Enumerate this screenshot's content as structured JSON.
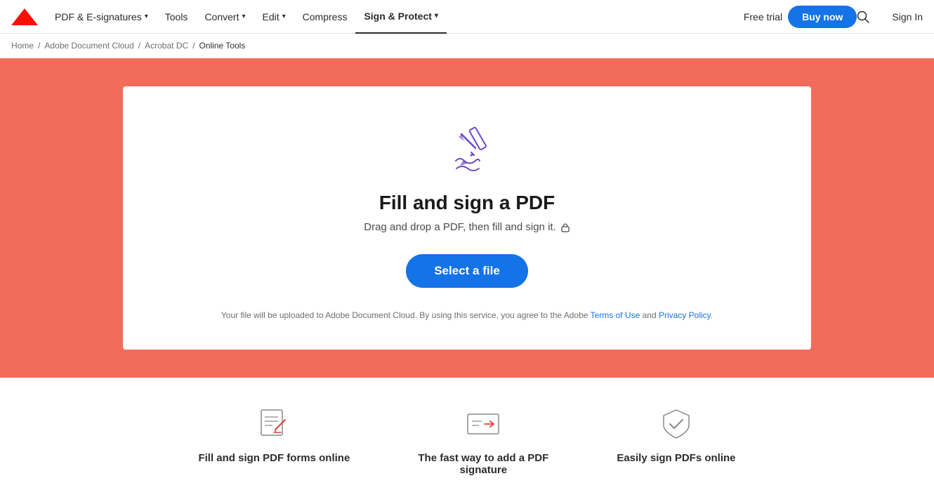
{
  "nav": {
    "logo_alt": "Adobe",
    "items": [
      {
        "label": "PDF & E-signatures",
        "has_chevron": true,
        "active": false
      },
      {
        "label": "Tools",
        "has_chevron": false,
        "active": false
      },
      {
        "label": "Convert",
        "has_chevron": true,
        "active": false
      },
      {
        "label": "Edit",
        "has_chevron": true,
        "active": false
      },
      {
        "label": "Compress",
        "has_chevron": false,
        "active": false
      },
      {
        "label": "Sign & Protect",
        "has_chevron": true,
        "active": true
      }
    ],
    "free_trial": "Free trial",
    "buy_now": "Buy now",
    "sign_in": "Sign In"
  },
  "breadcrumb": {
    "items": [
      {
        "label": "Home",
        "link": true
      },
      {
        "label": "Adobe Document Cloud",
        "link": true
      },
      {
        "label": "Acrobat DC",
        "link": true
      },
      {
        "label": "Online Tools",
        "link": false
      }
    ]
  },
  "card": {
    "title": "Fill and sign a PDF",
    "subtitle": "Drag and drop a PDF, then fill and sign it.",
    "select_btn": "Select a file",
    "legal_text_before": "Your file will be uploaded to Adobe Document Cloud.  By using this service, you agree to the Adobe ",
    "terms_label": "Terms of Use",
    "legal_and": " and ",
    "privacy_label": "Privacy Policy",
    "legal_period": "."
  },
  "features": [
    {
      "title": "Fill and sign PDF forms online"
    },
    {
      "title": "The fast way to add a PDF signature"
    },
    {
      "title": "Easily sign PDFs online"
    }
  ],
  "colors": {
    "background": "#f26b5b",
    "primary_btn": "#1473e6"
  }
}
